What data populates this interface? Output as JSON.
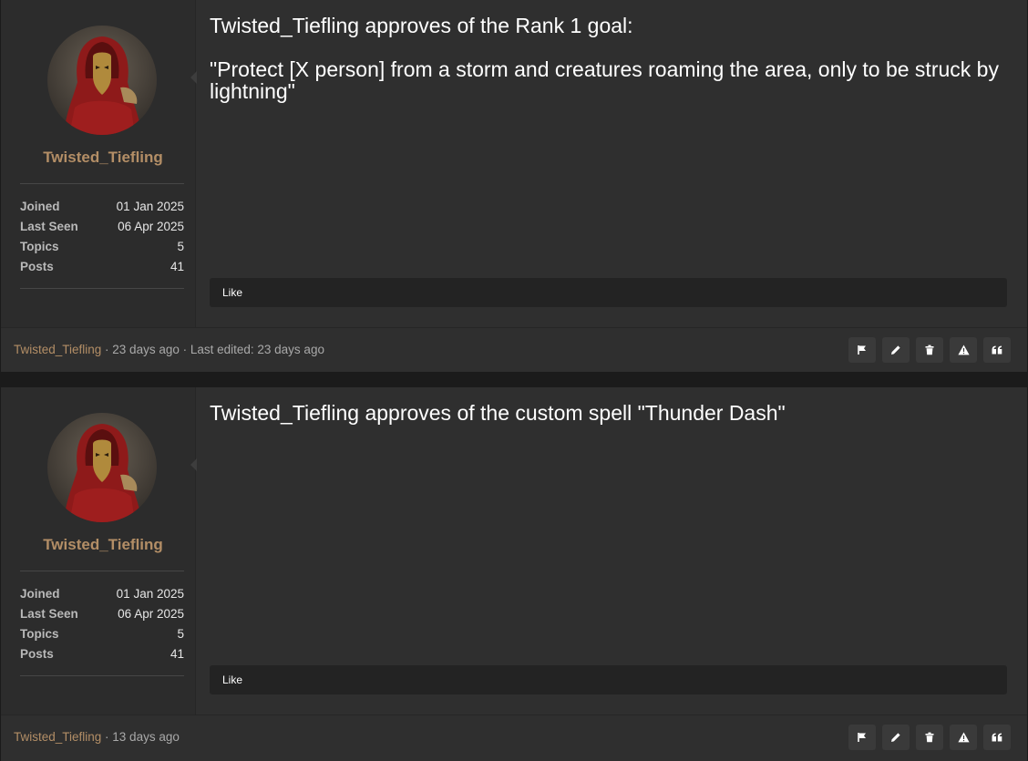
{
  "posts": [
    {
      "author": {
        "name": "Twisted_Tiefling",
        "stats": [
          {
            "label": "Joined",
            "value": "01 Jan 2025"
          },
          {
            "label": "Last Seen",
            "value": "06 Apr 2025"
          },
          {
            "label": "Topics",
            "value": "5"
          },
          {
            "label": "Posts",
            "value": "41"
          }
        ]
      },
      "content": [
        "Twisted_Tiefling approves of the Rank 1 goal:",
        "\"Protect [X person] from a storm and creatures roaming the area, only to be struck by lightning\""
      ],
      "like_label": "Like",
      "footer": {
        "author": "Twisted_Tiefling",
        "meta": " · 23 days ago · Last edited: 23 days ago"
      }
    },
    {
      "author": {
        "name": "Twisted_Tiefling",
        "stats": [
          {
            "label": "Joined",
            "value": "01 Jan 2025"
          },
          {
            "label": "Last Seen",
            "value": "06 Apr 2025"
          },
          {
            "label": "Topics",
            "value": "5"
          },
          {
            "label": "Posts",
            "value": "41"
          }
        ]
      },
      "content": [
        "Twisted_Tiefling approves of the custom spell \"Thunder Dash\""
      ],
      "like_label": "Like",
      "footer": {
        "author": "Twisted_Tiefling",
        "meta": " · 13 days ago"
      }
    }
  ],
  "actions": [
    "flag-icon",
    "edit-icon",
    "trash-icon",
    "warning-icon",
    "quote-icon"
  ],
  "colors": {
    "accent": "#b38e66",
    "panel": "#2f2f2f",
    "background": "#1b1b1b"
  }
}
